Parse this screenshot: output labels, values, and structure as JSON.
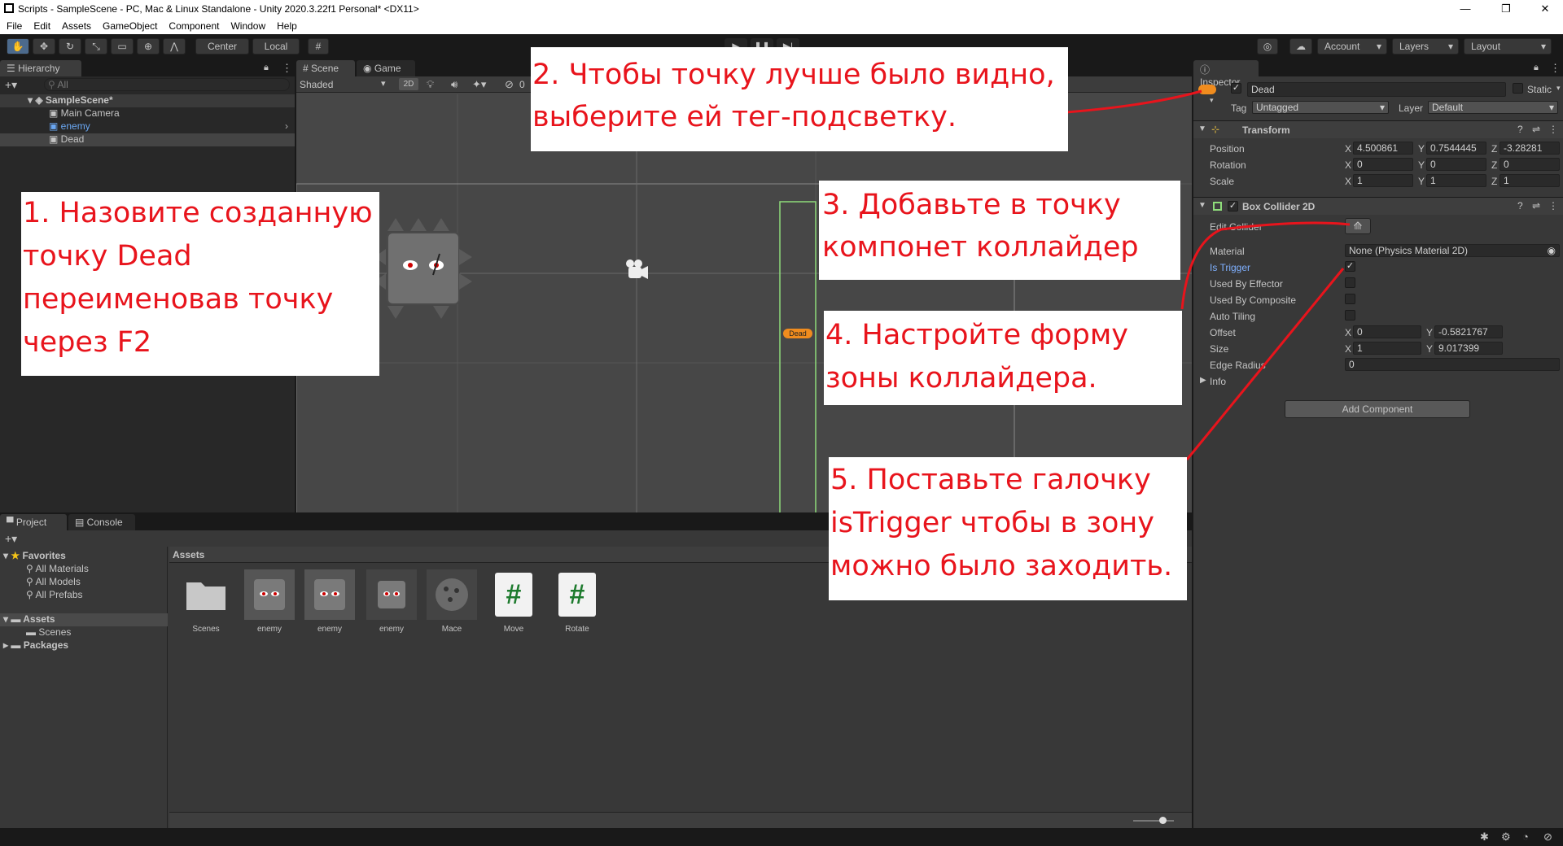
{
  "window": {
    "title": "Scripts - SampleScene - PC, Mac & Linux Standalone - Unity 2020.3.22f1 Personal* <DX11>",
    "min": "—",
    "max": "❐",
    "close": "✕"
  },
  "menu": [
    "File",
    "Edit",
    "Assets",
    "GameObject",
    "Component",
    "Window",
    "Help"
  ],
  "toolbar": {
    "center": "Center",
    "local": "Local",
    "account": "Account",
    "layers": "Layers",
    "layout": "Layout"
  },
  "hierarchy": {
    "tab": "Hierarchy",
    "search_placeholder": "All",
    "scene": "SampleScene*",
    "items": [
      "Main Camera",
      "enemy",
      "Dead"
    ]
  },
  "scene": {
    "tabs": [
      "Scene",
      "Game"
    ],
    "shading": "Shaded",
    "mode2d": "2D",
    "hidden_count": "0",
    "tag_label": "Dead"
  },
  "inspector": {
    "tab": "Inspector",
    "name": "Dead",
    "static": "Static",
    "tag_label": "Tag",
    "tag": "Untagged",
    "layer_label": "Layer",
    "layer": "Default",
    "transform": {
      "title": "Transform",
      "position": {
        "label": "Position",
        "x": "4.500861",
        "y": "0.7544445",
        "z": "-3.28281"
      },
      "rotation": {
        "label": "Rotation",
        "x": "0",
        "y": "0",
        "z": "0"
      },
      "scale": {
        "label": "Scale",
        "x": "1",
        "y": "1",
        "z": "1"
      }
    },
    "collider": {
      "title": "Box Collider 2D",
      "edit": "Edit Collider",
      "material_label": "Material",
      "material": "None (Physics Material 2D)",
      "is_trigger": "Is Trigger",
      "used_by_effector": "Used By Effector",
      "used_by_composite": "Used By Composite",
      "auto_tiling": "Auto Tiling",
      "offset": {
        "label": "Offset",
        "x": "0",
        "y": "-0.5821767"
      },
      "size": {
        "label": "Size",
        "x": "1",
        "y": "9.017399"
      },
      "edge_radius": {
        "label": "Edge Radius",
        "value": "0"
      },
      "info": "Info"
    },
    "add_component": "Add Component"
  },
  "project": {
    "tabs": [
      "Project",
      "Console"
    ],
    "favorites": "Favorites",
    "fav_items": [
      "All Materials",
      "All Models",
      "All Prefabs"
    ],
    "assets": "Assets",
    "scenes": "Scenes",
    "packages": "Packages",
    "breadcrumb": "Assets",
    "files": [
      "Scenes",
      "enemy",
      "enemy",
      "enemy",
      "Mace",
      "Move",
      "Rotate"
    ]
  },
  "annotations": {
    "a1": "1. Назовите созданную точку Dead переименовав точку через F2",
    "a2": "2. Чтобы точку лучше было видно, выберите ей тег-подсветку.",
    "a3": "3. Добавьте в точку компонет коллайдер",
    "a4": "4. Настройте форму зоны коллайдера.",
    "a5": "5. Поставьте галочку isTrigger чтобы в зону можно было заходить."
  },
  "colors": {
    "accent": "#4c6a8c",
    "annotation": "#e8141c",
    "collider": "#8edc7a",
    "tag": "#f08c1e"
  }
}
